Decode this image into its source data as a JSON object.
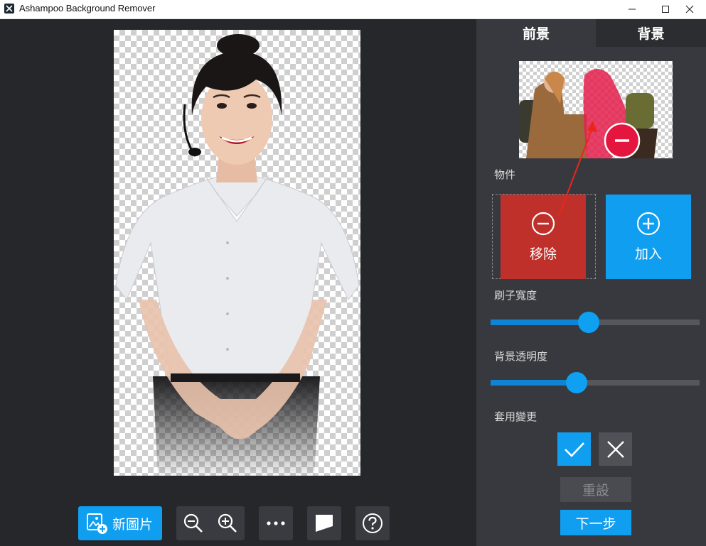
{
  "window": {
    "title": "Ashampoo Background Remover",
    "controls": [
      "minimize-icon",
      "maximize-icon",
      "close-icon"
    ]
  },
  "workspace": {
    "toolbar": {
      "new_image_label": "新圖片",
      "icons": [
        "add-image-icon",
        "zoom-out-icon",
        "zoom-in-icon",
        "more-icon",
        "background-toggle-icon",
        "help-icon"
      ]
    }
  },
  "panel": {
    "tabs": [
      {
        "label": "前景",
        "active": true
      },
      {
        "label": "背景",
        "active": false
      }
    ],
    "object_label": "物件",
    "remove_label": "移除",
    "add_label": "加入",
    "brush_label": "刷子寬度",
    "brush_width_fraction": 0.47,
    "opacity_label": "背景透明度",
    "bg_opacity_fraction": 0.41,
    "apply_label": "套用變更",
    "reset_label": "重設",
    "next_label": "下一步"
  },
  "colors": {
    "accent": "#0f9ef0",
    "remove": "#c0302a",
    "panel_bg": "#38393e",
    "workspace_bg": "#26272b",
    "annotation_arrow": "#e8261c"
  }
}
